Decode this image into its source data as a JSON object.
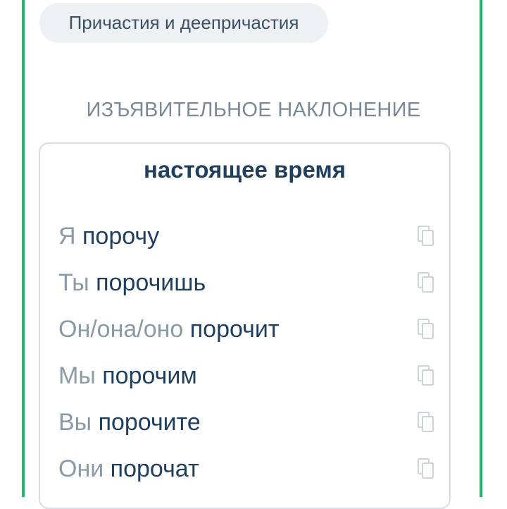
{
  "chip": {
    "label": "Причастия и деепричастия"
  },
  "section": {
    "title": "ИЗЪЯВИТЕЛЬНОЕ НАКЛОНЕНИЕ"
  },
  "card": {
    "tense_title": "настоящее время",
    "rows": [
      {
        "pronoun": "Я",
        "verb": "порочу",
        "icon": "copy-icon"
      },
      {
        "pronoun": "Ты",
        "verb": "порочишь",
        "icon": "copy-icon"
      },
      {
        "pronoun": "Он/она/оно",
        "verb": "порочит",
        "icon": "copy-icon"
      },
      {
        "pronoun": "Мы",
        "verb": "порочим",
        "icon": "copy-icon"
      },
      {
        "pronoun": "Вы",
        "verb": "порочите",
        "icon": "copy-icon"
      },
      {
        "pronoun": "Они",
        "verb": "порочат",
        "icon": "copy-icon"
      }
    ]
  },
  "colors": {
    "frame_border": "#1fb86a",
    "verb": "#1f3f5f",
    "pronoun": "#8a9aa6"
  }
}
